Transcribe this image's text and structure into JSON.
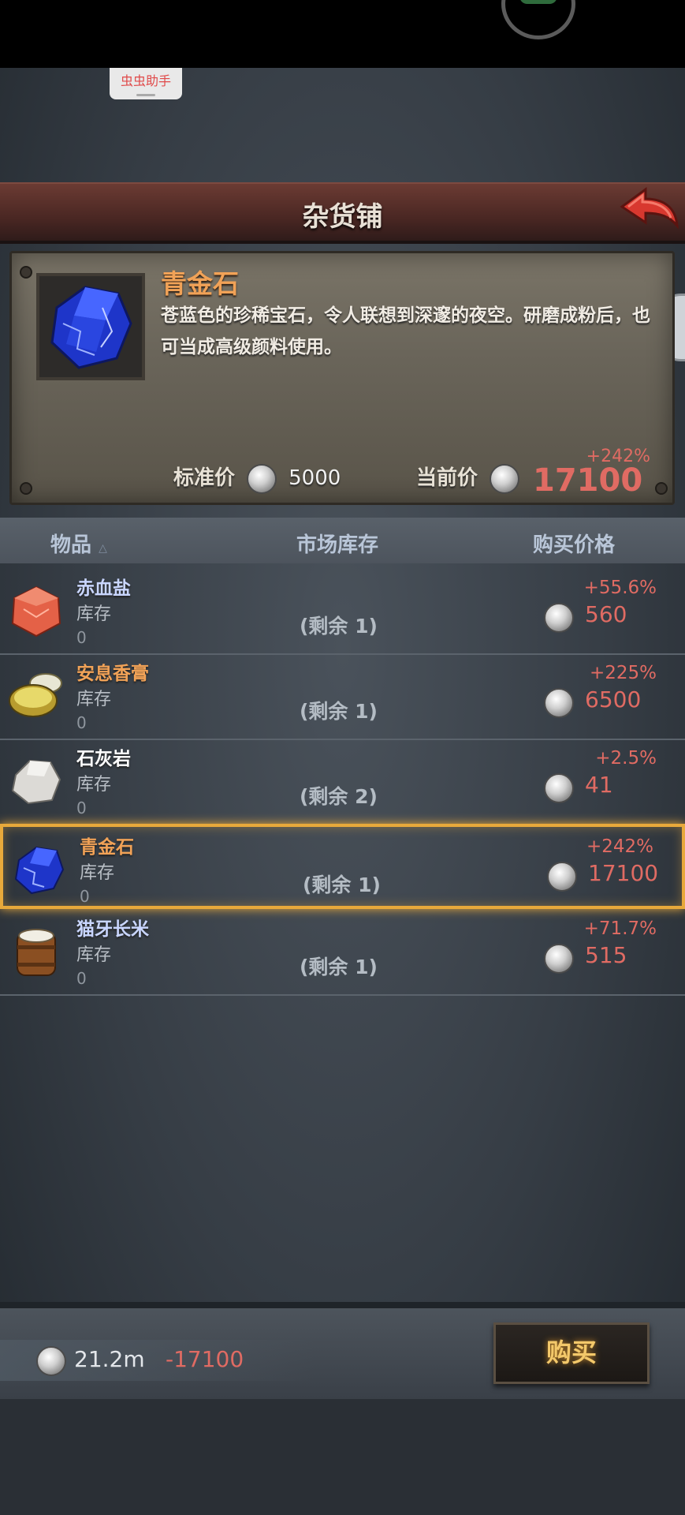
{
  "overlay": {
    "helper_label": "虫虫助手"
  },
  "header": {
    "title": "杂货铺"
  },
  "detail": {
    "name": "青金石",
    "description": "苍蓝色的珍稀宝石，令人联想到深邃的夜空。研磨成粉后，也可当成高级颜料使用。",
    "standard_price_label": "标准价",
    "standard_price": "5000",
    "current_price_label": "当前价",
    "current_price": "17100",
    "change_pct": "+242%"
  },
  "table": {
    "columns": {
      "item": "物品",
      "market_stock": "市场库存",
      "buy_price": "购买价格"
    },
    "rows": [
      {
        "name": "赤血盐",
        "stock_label": "库存",
        "stock_value": "0",
        "remaining": "(剩余 1)",
        "change_pct": "+55.6%",
        "price": "560",
        "name_color": "#c9d6ff",
        "icon": "red-salt-icon"
      },
      {
        "name": "安息香膏",
        "stock_label": "库存",
        "stock_value": "0",
        "remaining": "(剩余 1)",
        "change_pct": "+225%",
        "price": "6500",
        "name_color": "#f1a257",
        "icon": "ointment-jar-icon"
      },
      {
        "name": "石灰岩",
        "stock_label": "库存",
        "stock_value": "0",
        "remaining": "(剩余 2)",
        "change_pct": "+2.5%",
        "price": "41",
        "name_color": "#ffffff",
        "icon": "limestone-icon"
      },
      {
        "name": "青金石",
        "stock_label": "库存",
        "stock_value": "0",
        "remaining": "(剩余 1)",
        "change_pct": "+242%",
        "price": "17100",
        "name_color": "#f1a257",
        "icon": "lapis-gem-icon",
        "selected": true
      },
      {
        "name": "猫牙长米",
        "stock_label": "库存",
        "stock_value": "0",
        "remaining": "(剩余 1)",
        "change_pct": "+71.7%",
        "price": "515",
        "name_color": "#c9d6ff",
        "icon": "rice-barrel-icon"
      }
    ]
  },
  "footer": {
    "wallet_amount": "21.2m",
    "wallet_delta": "-17100",
    "buy_label": "购买"
  },
  "colors": {
    "accent_orange": "#f1a257",
    "price_red": "#e06b63",
    "selection": "#e8a93b"
  }
}
